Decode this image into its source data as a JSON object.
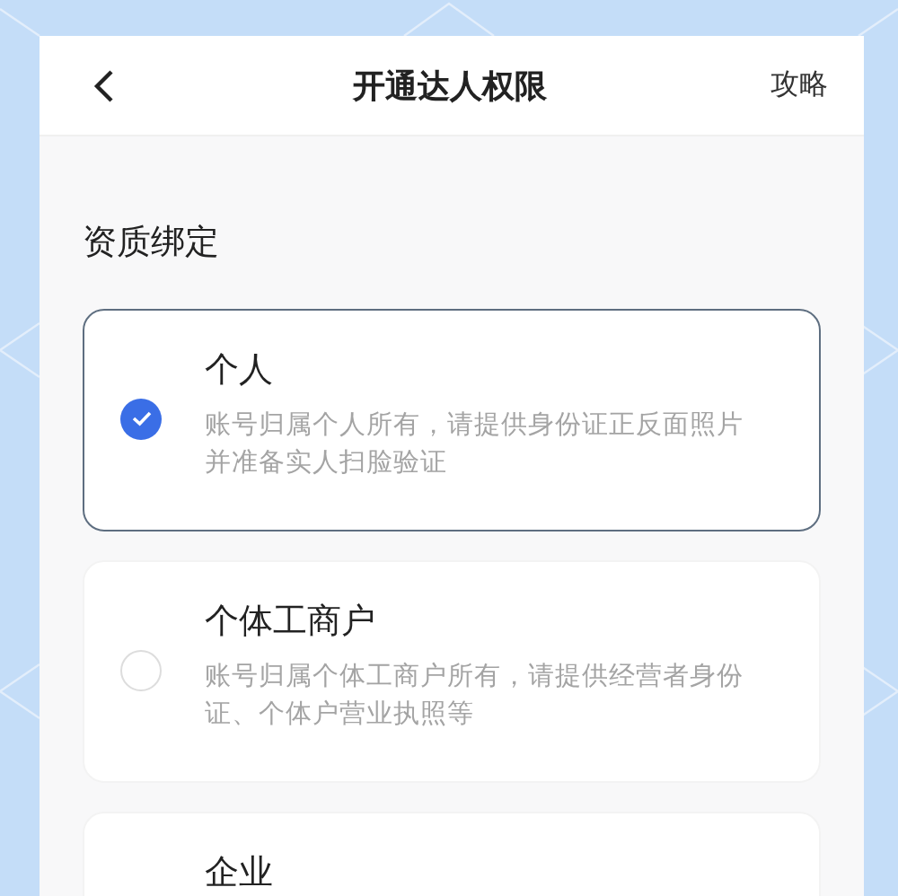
{
  "header": {
    "title": "开通达人权限",
    "action": "攻略"
  },
  "section_title": "资质绑定",
  "options": [
    {
      "title": "个人",
      "description": "账号归属个人所有，请提供身份证正反面照片并准备实人扫脸验证",
      "selected": true
    },
    {
      "title": "个体工商户",
      "description": "账号归属个体工商户所有，请提供经营者身份证、个体户营业执照等",
      "selected": false
    },
    {
      "title": "企业"
    }
  ]
}
